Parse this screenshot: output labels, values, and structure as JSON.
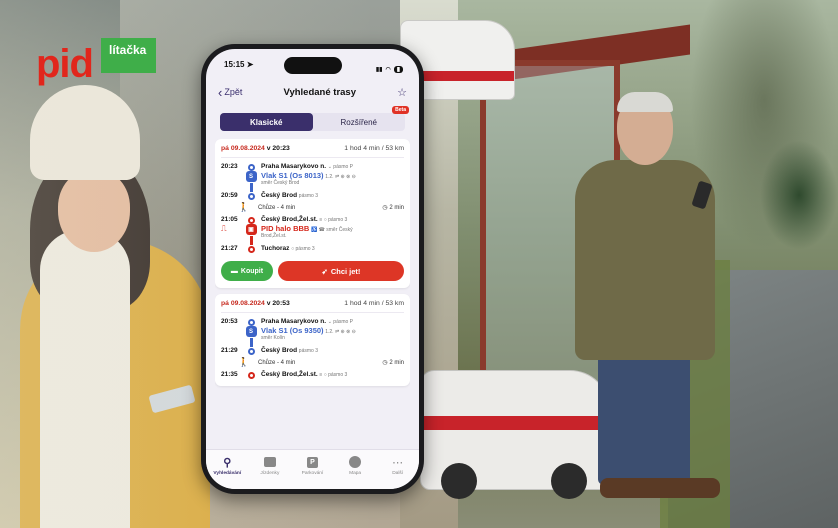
{
  "brand": {
    "name": "pid",
    "badge": "lítačka",
    "red": "#e1261c",
    "green": "#3fae49"
  },
  "status": {
    "time": "15:15",
    "location_icon": "location-arrow-icon"
  },
  "nav": {
    "back_label": "Zpět",
    "title": "Vyhledané trasy",
    "favorite_icon": "star-icon"
  },
  "tabs": [
    {
      "label": "Klasické",
      "active": true
    },
    {
      "label": "Rozšířené",
      "active": false,
      "badge": "Beta"
    }
  ],
  "routes": [
    {
      "date": "pá 09.08.2024",
      "time_word": "v",
      "time": "20:23",
      "duration": "1 hod 4 min / 53 km",
      "legs": [
        {
          "dep_time": "20:23",
          "dep_stop": "Praha Masarykovo n.",
          "dep_platform": "⌄ pásmo P",
          "line_label": "Vlak S1 (Os 8013)",
          "line_extra": "1.2. ⇌ ⊕ ⊗ ⊖",
          "direction": "směr Český Brod",
          "arr_time": "20:59",
          "arr_stop": "Český Brod",
          "arr_platform": "pásmo 3",
          "color": "blue"
        }
      ],
      "walk": {
        "label": "Chůze - 4 min",
        "time": "2 min"
      },
      "legs2": [
        {
          "dep_time": "21:05",
          "dep_stop": "Český Brod,Žel.st.",
          "dep_platform": "≡ ○ pásmo 3",
          "line_label": "PID halo BBB",
          "line_extra": "♿ ☎ směr Český",
          "direction": "Brod,Žel.st.",
          "arr_time": "21:27",
          "arr_stop": "Tuchoraz",
          "arr_platform": "○ pásmo 3",
          "color": "red"
        }
      ],
      "buy_label": "Koupit",
      "go_label": "Chci jet!"
    },
    {
      "date": "pá 09.08.2024",
      "time_word": "v",
      "time": "20:53",
      "duration": "1 hod 4 min / 53 km",
      "legs": [
        {
          "dep_time": "20:53",
          "dep_stop": "Praha Masarykovo n.",
          "dep_platform": "⌄ pásmo P",
          "line_label": "Vlak S1 (Os 9350)",
          "line_extra": "1.2. ⇌ ⊕ ⊗ ⊖",
          "direction": "směr Kolín",
          "arr_time": "21:29",
          "arr_stop": "Český Brod",
          "arr_platform": "pásmo 3",
          "color": "blue"
        }
      ],
      "walk": {
        "label": "Chůze - 4 min",
        "time": "2 min"
      },
      "peek": {
        "time": "21:35",
        "stop": "Český Brod,Žel.st.",
        "platform": "≡ ○ pásmo 3"
      }
    }
  ],
  "tabbar": [
    {
      "label": "Vyhledávání",
      "icon": "search-icon",
      "active": true
    },
    {
      "label": "Jízdenky",
      "icon": "ticket-icon",
      "active": false
    },
    {
      "label": "Parkování",
      "icon": "parking-icon",
      "active": false
    },
    {
      "label": "Mapa",
      "icon": "map-icon",
      "active": false
    },
    {
      "label": "Další",
      "icon": "more-icon",
      "active": false
    }
  ]
}
